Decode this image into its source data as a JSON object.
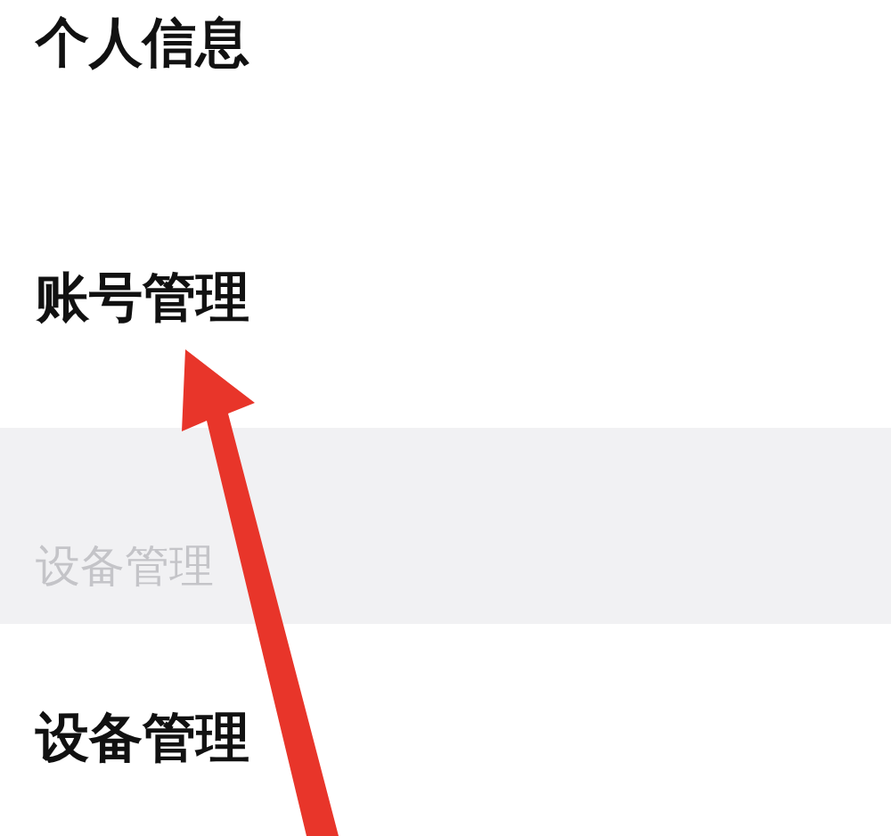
{
  "rows": [
    {
      "kind": "item",
      "label": "个人信息"
    },
    {
      "kind": "item",
      "label": "账号管理"
    },
    {
      "kind": "section",
      "label": "设备管理"
    },
    {
      "kind": "item",
      "label": "设备管理"
    }
  ],
  "annotation": {
    "kind": "arrow",
    "color": "#e8352a"
  }
}
